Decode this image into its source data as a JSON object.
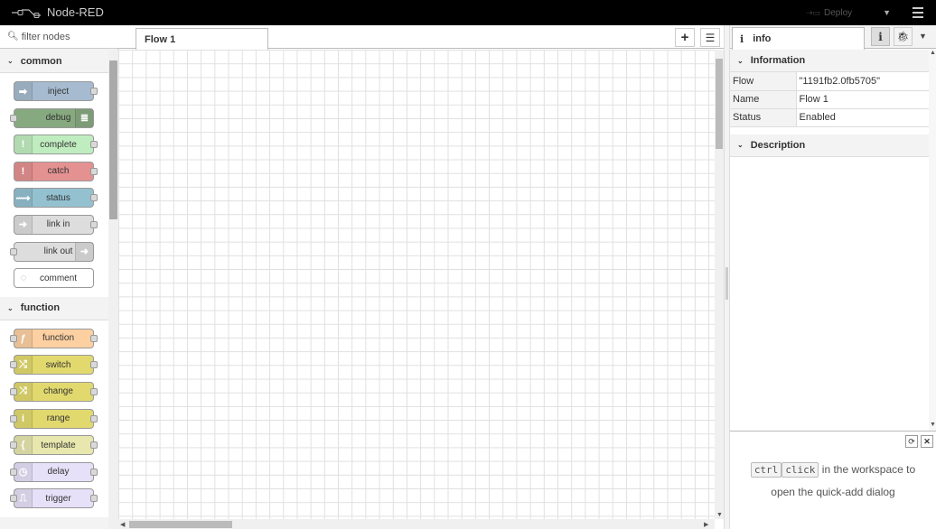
{
  "header": {
    "title": "Node-RED",
    "deploy_label": "Deploy"
  },
  "palette": {
    "search_placeholder": "filter nodes",
    "categories": [
      {
        "name": "common",
        "nodes": [
          {
            "label": "inject",
            "color": "#a6bbcf",
            "icon": "arrow-in-icon",
            "glyph": "➡",
            "side": "left",
            "in": false,
            "out": true
          },
          {
            "label": "debug",
            "color": "#87a980",
            "icon": "list-icon",
            "glyph": "≣",
            "side": "right",
            "in": true,
            "out": false
          },
          {
            "label": "complete",
            "color": "#c0edc0",
            "icon": "alert-icon",
            "glyph": "!",
            "side": "left",
            "in": false,
            "out": true
          },
          {
            "label": "catch",
            "color": "#e49191",
            "icon": "alert-icon",
            "glyph": "!",
            "side": "left",
            "in": false,
            "out": true
          },
          {
            "label": "status",
            "color": "#94c1d0",
            "icon": "pulse-icon",
            "glyph": "⟿",
            "side": "left",
            "in": false,
            "out": true
          },
          {
            "label": "link in",
            "color": "#dddddd",
            "icon": "link-in-icon",
            "glyph": "➜",
            "side": "left",
            "in": false,
            "out": true
          },
          {
            "label": "link out",
            "color": "#dddddd",
            "icon": "link-out-icon",
            "glyph": "➜",
            "side": "right",
            "in": true,
            "out": false
          },
          {
            "label": "comment",
            "color": "#ffffff",
            "icon": "comment-icon",
            "glyph": "◌",
            "side": "left",
            "in": false,
            "out": false
          }
        ]
      },
      {
        "name": "function",
        "nodes": [
          {
            "label": "function",
            "color": "#fdd0a2",
            "icon": "function-icon",
            "glyph": "ƒ",
            "side": "left",
            "in": true,
            "out": true
          },
          {
            "label": "switch",
            "color": "#e2d96e",
            "icon": "switch-icon",
            "glyph": "⤮",
            "side": "left",
            "in": true,
            "out": true
          },
          {
            "label": "change",
            "color": "#e2d96e",
            "icon": "shuffle-icon",
            "glyph": "⤨",
            "side": "left",
            "in": true,
            "out": true
          },
          {
            "label": "range",
            "color": "#e2d96e",
            "icon": "range-icon",
            "glyph": "ί",
            "side": "left",
            "in": true,
            "out": true
          },
          {
            "label": "template",
            "color": "#e7e7ae",
            "icon": "template-icon",
            "glyph": "{",
            "side": "left",
            "in": true,
            "out": true
          },
          {
            "label": "delay",
            "color": "#e6e0f8",
            "icon": "timer-icon",
            "glyph": "◷",
            "side": "left",
            "in": true,
            "out": true
          },
          {
            "label": "trigger",
            "color": "#e6e0f8",
            "icon": "trigger-icon",
            "glyph": "⎍",
            "side": "left",
            "in": true,
            "out": true
          }
        ]
      }
    ]
  },
  "workspace": {
    "tabs": [
      {
        "label": "Flow 1"
      }
    ]
  },
  "sidebar": {
    "tab_label": "info",
    "info_section": "Information",
    "info_rows": [
      {
        "key": "Flow",
        "value": "\"1191fb2.0fb5705\""
      },
      {
        "key": "Name",
        "value": "Flow 1"
      },
      {
        "key": "Status",
        "value": "Enabled"
      }
    ],
    "description_section": "Description",
    "help": {
      "kbd1": "ctrl",
      "kbd2": "click",
      "text_after": " in the workspace to",
      "line2": "open the quick-add dialog"
    }
  }
}
